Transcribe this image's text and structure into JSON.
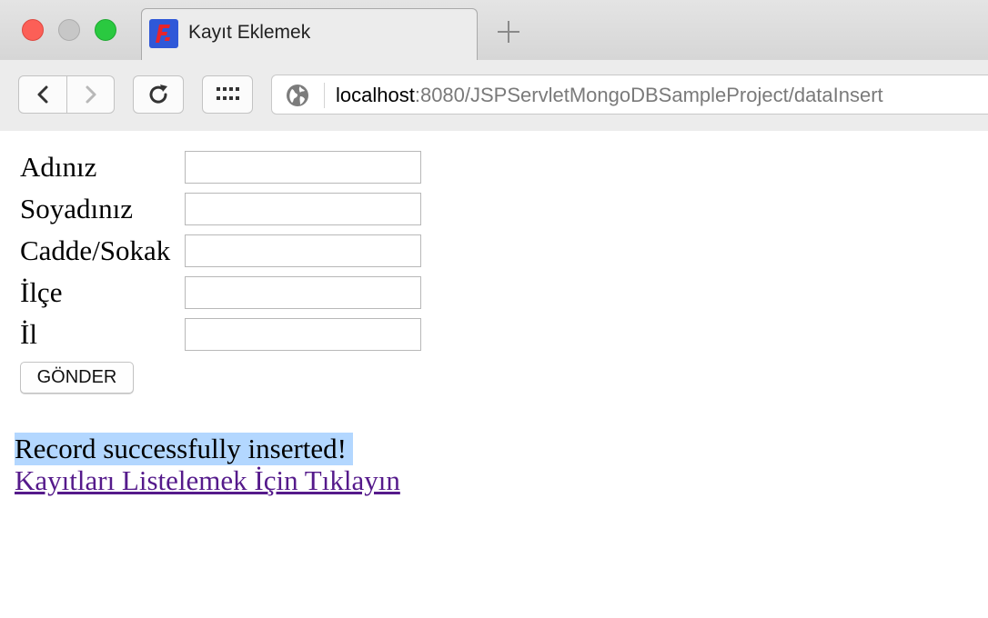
{
  "browser": {
    "tab_title": "Kayıt Eklemek",
    "url_host": "localhost",
    "url_rest": ":8080/JSPServletMongoDBSampleProject/dataInsert",
    "icons": [
      "close-icon",
      "minimize-icon",
      "maximize-icon",
      "favicon-icon",
      "new-tab-icon",
      "back-icon",
      "forward-icon",
      "reload-icon",
      "apps-icon",
      "globe-icon"
    ]
  },
  "form": {
    "fields": [
      {
        "label": "Adınız",
        "value": ""
      },
      {
        "label": "Soyadınız",
        "value": ""
      },
      {
        "label": "Cadde/Sokak",
        "value": ""
      },
      {
        "label": "İlçe",
        "value": ""
      },
      {
        "label": "İl",
        "value": ""
      }
    ],
    "submit_label": "GÖNDER"
  },
  "result": {
    "message": "Record successfully inserted!",
    "link_text": "Kayıtları Listelemek İçin Tıklayın"
  },
  "colors": {
    "selection_highlight": "#b3d7ff",
    "visited_link": "#551a8b",
    "favicon_bg": "#2f58d8"
  }
}
